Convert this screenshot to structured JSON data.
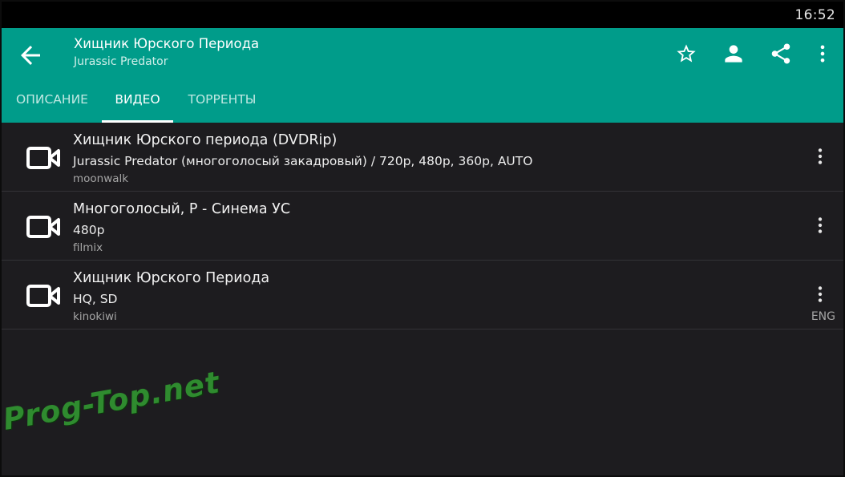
{
  "status_bar": {
    "time": "16:52"
  },
  "app_bar": {
    "title": "Хищник Юрского Периода",
    "subtitle": "Jurassic Predator",
    "icons": [
      "back-arrow-icon",
      "star-outline-icon",
      "person-icon",
      "share-icon",
      "more-vert-icon"
    ]
  },
  "tabs": [
    {
      "label": "ОПИСАНИЕ",
      "active": false
    },
    {
      "label": "ВИДЕО",
      "active": true
    },
    {
      "label": "ТОРРЕНТЫ",
      "active": false
    }
  ],
  "videos": [
    {
      "title": "Хищник Юрского периода (DVDRip)",
      "details": "Jurassic Predator (многоголосый закадровый) / 720p, 480p, 360p, AUTO",
      "source": "moonwalk",
      "lang": ""
    },
    {
      "title": "Многоголосый, Р - Синема УС",
      "details": "480p",
      "source": "filmix",
      "lang": ""
    },
    {
      "title": "Хищник Юрского Периода",
      "details": "HQ, SD",
      "source": "kinokiwi",
      "lang": "ENG"
    }
  ],
  "watermark": "Prog-Top.net",
  "colors": {
    "accent": "#009c8a",
    "background": "#1d1c1f",
    "status_bar": "#000000"
  }
}
